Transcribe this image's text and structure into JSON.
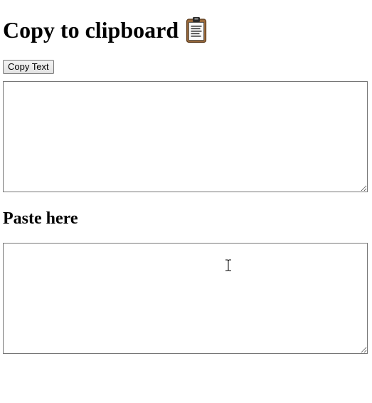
{
  "header": {
    "title": "Copy to clipboard",
    "title_icon": "clipboard-icon"
  },
  "toolbar": {
    "copy_label": "Copy Text"
  },
  "copy_area": {
    "value": ""
  },
  "paste_section": {
    "heading": "Paste here",
    "value": ""
  },
  "pointer": {
    "icon": "text-cursor-icon"
  }
}
